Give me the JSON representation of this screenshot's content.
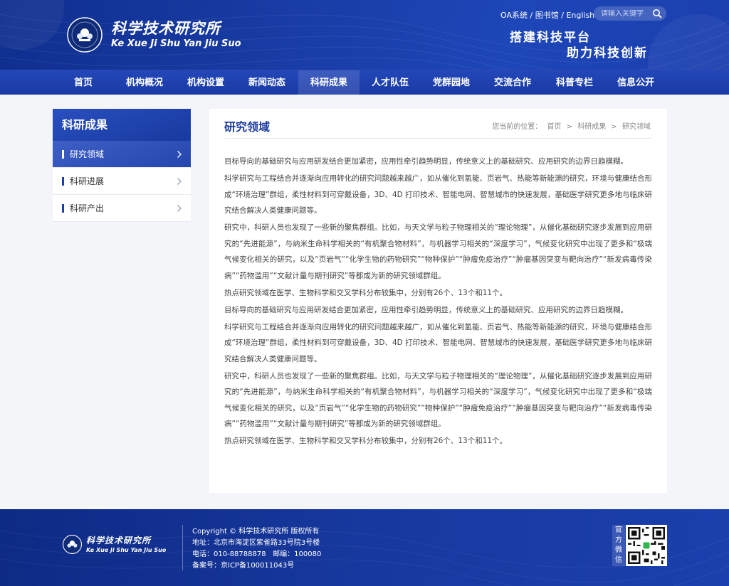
{
  "site": {
    "name_cn": "科学技术研究所",
    "name_en": "Ke Xue Ji Shu Yan Jiu Suo",
    "slogan_line1": "搭建科技平台",
    "slogan_line2": "助力科技创新"
  },
  "top_links": {
    "oa": "OA系统",
    "sep1": "/",
    "library": "图书馆",
    "sep2": "/",
    "english": "English"
  },
  "search": {
    "placeholder": "请输入关键字"
  },
  "nav": {
    "items": [
      "首页",
      "机构概况",
      "机构设置",
      "新闻动态",
      "科研成果",
      "人才队伍",
      "党群园地",
      "交流合作",
      "科普专栏",
      "信息公开"
    ],
    "active_index": 4
  },
  "sidebar": {
    "title": "科研成果",
    "items": [
      {
        "label": "研究领域",
        "active": true
      },
      {
        "label": "科研进展",
        "active": false
      },
      {
        "label": "科研产出",
        "active": false
      }
    ]
  },
  "main": {
    "title": "研究领域",
    "breadcrumb": {
      "prefix": "您当前的位置：",
      "items": [
        "首页",
        "科研成果",
        "研究领域"
      ],
      "sep": ">"
    },
    "paragraphs": [
      "目标导向的基础研究与应用研发结合更加紧密，应用性牵引趋势明显，传统意义上的基础研究、应用研究的边界日趋模糊。",
      "科学研究与工程结合并逐渐向应用转化的研究问题越来越广，如从催化到氢能、页岩气、热能等新能源的研究，环境与健康结合形成“环境治理”群组，柔性材料到可穿戴设备，3D、4D 打印技术、智能电网、智慧城市的快速发展，基础医学研究更多地与临床研究结合解决人类健康问题等。",
      "研究中，科研人员也发现了一些新的聚焦群组。比如，与天文学与粒子物理相关的“理论物理”，从催化基础研究逐步发展到应用研究的“先进能源”，与纳米生命科学相关的“有机聚合物材料”，与机器学习相关的“深度学习”，气候变化研究中出现了更多和“极端气候变化相关的研究，以及“页岩气”“化学生物的药物研究”“物种保护”“肿瘤免疫治疗”“肿瘤基因突变与靶向治疗”“新发病毒传染病”“药物滥用”“文献计量与期刊研究”等都成为新的研究领域群组。",
      "热点研究领域在医学、生物科学和交叉学科分布较集中，分别有26个、13个和11个。",
      "目标导向的基础研究与应用研发结合更加紧密，应用性牵引趋势明显，传统意义上的基础研究、应用研究的边界日趋模糊。",
      "科学研究与工程结合并逐渐向应用转化的研究问题越来越广，如从催化到氢能、页岩气、热能等新能源的研究，环境与健康结合形成“环境治理”群组，柔性材料到可穿戴设备，3D、4D 打印技术、智能电网、智慧城市的快速发展，基础医学研究更多地与临床研究结合解决人类健康问题等。",
      "研究中，科研人员也发现了一些新的聚焦群组。比如，与天文学与粒子物理相关的“理论物理”，从催化基础研究逐步发展到应用研究的“先进能源”，与纳米生命科学相关的“有机聚合物材料”，与机器学习相关的“深度学习”，气候变化研究中出现了更多和“极端气候变化相关的研究，以及“页岩气”“化学生物的药物研究”“物种保护”“肿瘤免疫治疗”“肿瘤基因突变与靶向治疗”“新发病毒传染病”“药物滥用”“文献计量与期刊研究”等都成为新的研究领域群组。",
      "热点研究领域在医学、生物科学和交叉学科分布较集中，分别有26个、13个和11个。"
    ]
  },
  "footer": {
    "copyright": "Copyright © 科学技术研究所 版权所有",
    "address": "地址：北京市海淀区紫雀路33号院3号楼",
    "phone": "电话：010-88788878   邮编：100080",
    "icp": "备案号：京ICP备100011043号",
    "qr_label": "官方微信"
  },
  "colors": {
    "brand": "#1d3c9f",
    "header_bg": "#1a3ea8",
    "nav_bg": "#2347b8",
    "page_bg": "#f3f5f9"
  },
  "icons": {
    "search": "search-icon",
    "chevron": "chevron-right-icon",
    "emblem": "institute-emblem-icon",
    "qr": "qr-code"
  }
}
